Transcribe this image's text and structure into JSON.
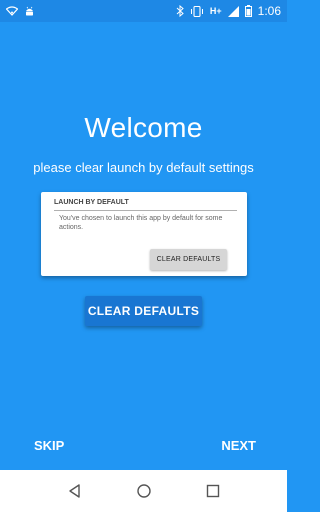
{
  "status_bar": {
    "network_label": "H+",
    "time": "1:06"
  },
  "main": {
    "title": "Welcome",
    "subtitle": "please clear launch by default settings",
    "primary_button": "CLEAR DEFAULTS"
  },
  "card": {
    "header": "LAUNCH BY DEFAULT",
    "body": "You've chosen to launch this app by default for some actions.",
    "button": "CLEAR DEFAULTS"
  },
  "footer": {
    "skip_label": "SKIP",
    "next_label": "NEXT"
  },
  "nav_bar": {
    "icons": [
      "back-icon",
      "home-icon",
      "recents-icon"
    ]
  },
  "colors": {
    "background": "#2196F3",
    "status_bar": "#1E88E5",
    "primary_button": "#1976D2",
    "nav_bar": "#FFFFFF"
  }
}
